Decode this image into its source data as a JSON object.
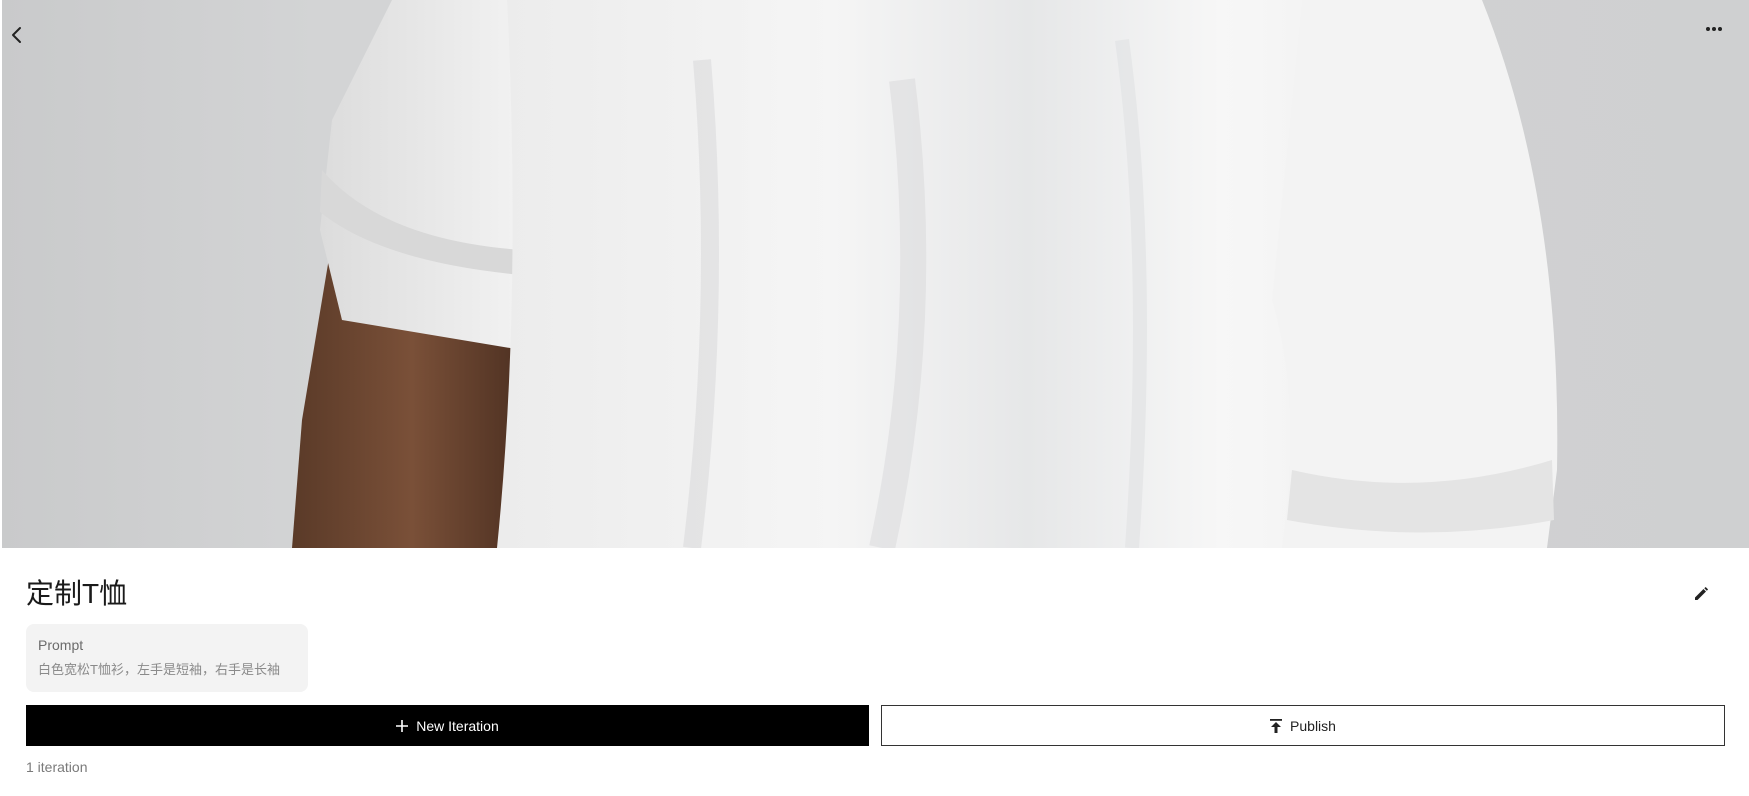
{
  "header": {
    "back_icon": "chevron-left-icon",
    "more_icon": "more-horizontal-icon"
  },
  "project": {
    "title": "定制T恤",
    "edit_icon": "pencil-icon"
  },
  "prompt": {
    "label": "Prompt",
    "text": "白色宽松T恤衫，左手是短袖，右手是长袖"
  },
  "actions": {
    "new_iteration_label": "New Iteration",
    "new_iteration_icon": "plus-icon",
    "publish_label": "Publish",
    "publish_icon": "upload-icon"
  },
  "footer": {
    "iteration_count": "1 iteration"
  },
  "colors": {
    "primary_button": "#000000",
    "background": "#ffffff",
    "prompt_box": "#f3f3f3"
  }
}
